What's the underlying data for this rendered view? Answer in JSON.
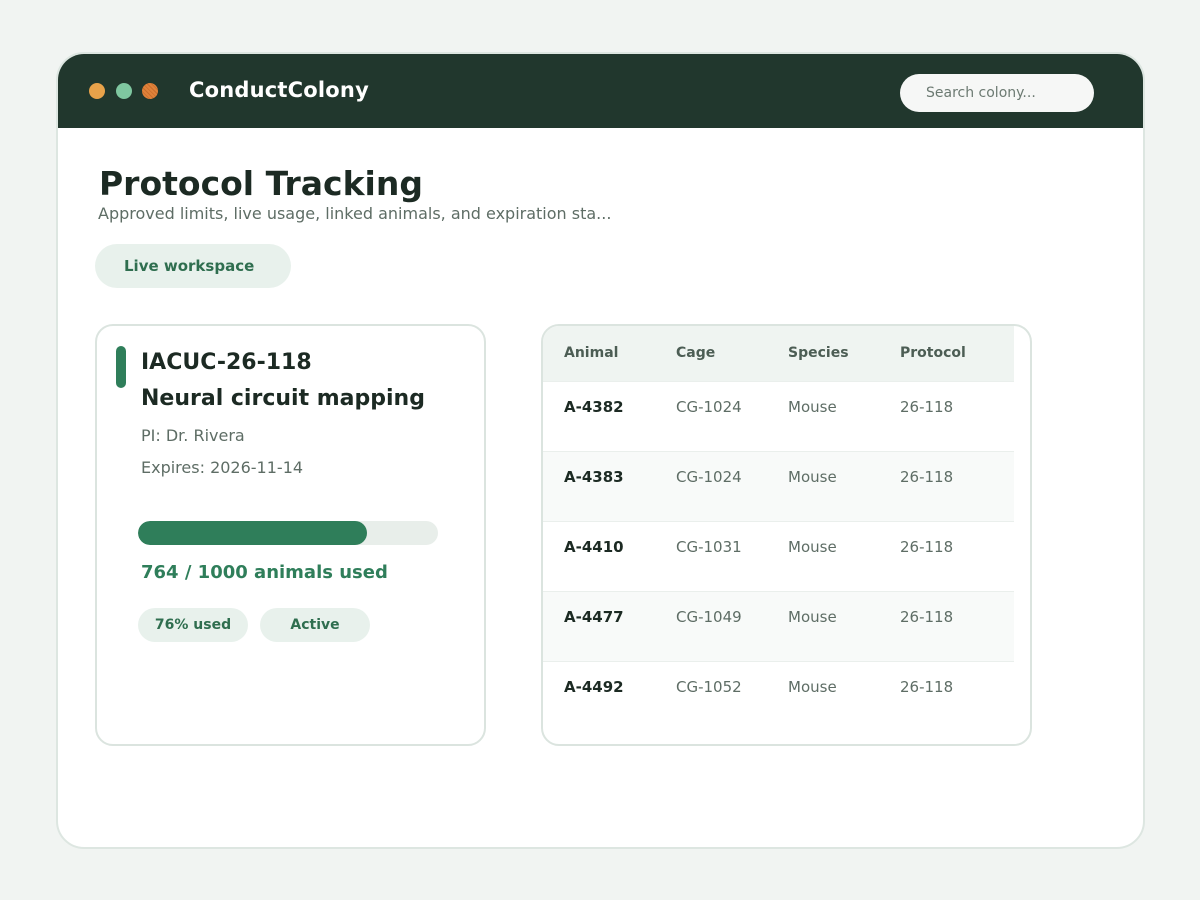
{
  "app": {
    "title": "ConductColony",
    "search": {
      "placeholder": "Search colony..."
    }
  },
  "page": {
    "title": "Protocol Tracking",
    "subtitle": "Approved limits, live usage, linked animals, and expiration sta...",
    "workspace_label": "Live workspace"
  },
  "protocol": {
    "id": "IACUC-26-118",
    "name": "Neural circuit mapping",
    "pi": "PI: Dr. Rivera",
    "expires": "Expires: 2026-11-14",
    "used": 764,
    "limit": 1000,
    "usage_fraction": 0.764,
    "usage_text": "764 / 1000 animals used",
    "percent_badge": "76% used",
    "status_badge": "Active"
  },
  "table": {
    "columns": [
      "Animal",
      "Cage",
      "Species",
      "Protocol"
    ],
    "rows": [
      [
        "A-4382",
        "CG-1024",
        "Mouse",
        "26-118"
      ],
      [
        "A-4383",
        "CG-1024",
        "Mouse",
        "26-118"
      ],
      [
        "A-4410",
        "CG-1031",
        "Mouse",
        "26-118"
      ],
      [
        "A-4477",
        "CG-1049",
        "Mouse",
        "26-118"
      ],
      [
        "A-4492",
        "CG-1052",
        "Mouse",
        "26-118"
      ]
    ]
  },
  "colors": {
    "titlebar": "#21372d",
    "accent": "#2f7e5a",
    "pill_bg": "#e8f1ec"
  },
  "icons": {
    "window_controls": [
      "window-dot-orange-icon",
      "window-dot-green-icon",
      "window-dot-amber-icon"
    ]
  }
}
